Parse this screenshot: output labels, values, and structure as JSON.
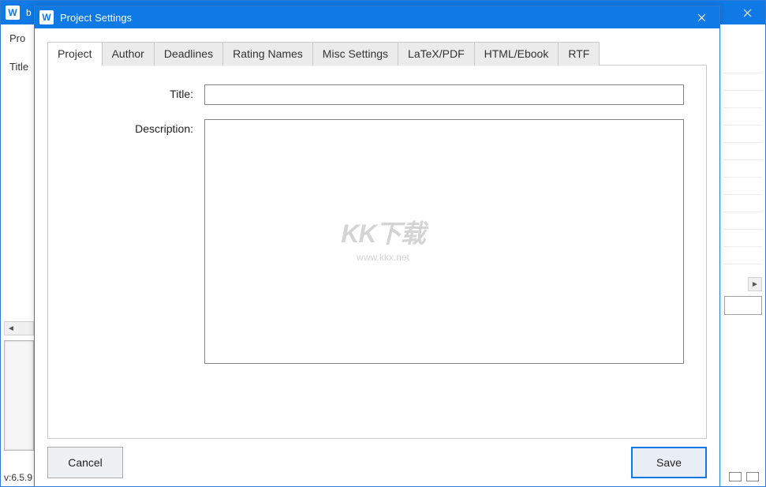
{
  "parentWindow": {
    "title": "b",
    "leftTabs": [
      "Pro",
      "Title"
    ],
    "version": "v:6.5.9"
  },
  "dialog": {
    "title": "Project Settings",
    "tabs": [
      {
        "id": "project",
        "label": "Project",
        "active": true
      },
      {
        "id": "author",
        "label": "Author",
        "active": false
      },
      {
        "id": "deadlines",
        "label": "Deadlines",
        "active": false
      },
      {
        "id": "rating-names",
        "label": "Rating Names",
        "active": false
      },
      {
        "id": "misc-settings",
        "label": "Misc Settings",
        "active": false
      },
      {
        "id": "latex-pdf",
        "label": "LaTeX/PDF",
        "active": false
      },
      {
        "id": "html-ebook",
        "label": "HTML/Ebook",
        "active": false
      },
      {
        "id": "rtf",
        "label": "RTF",
        "active": false
      }
    ],
    "form": {
      "titleLabel": "Title:",
      "titleValue": "",
      "descriptionLabel": "Description:",
      "descriptionValue": ""
    },
    "buttons": {
      "cancel": "Cancel",
      "save": "Save"
    }
  },
  "watermark": {
    "big": "KK下载",
    "small": "www.kkx.net"
  }
}
